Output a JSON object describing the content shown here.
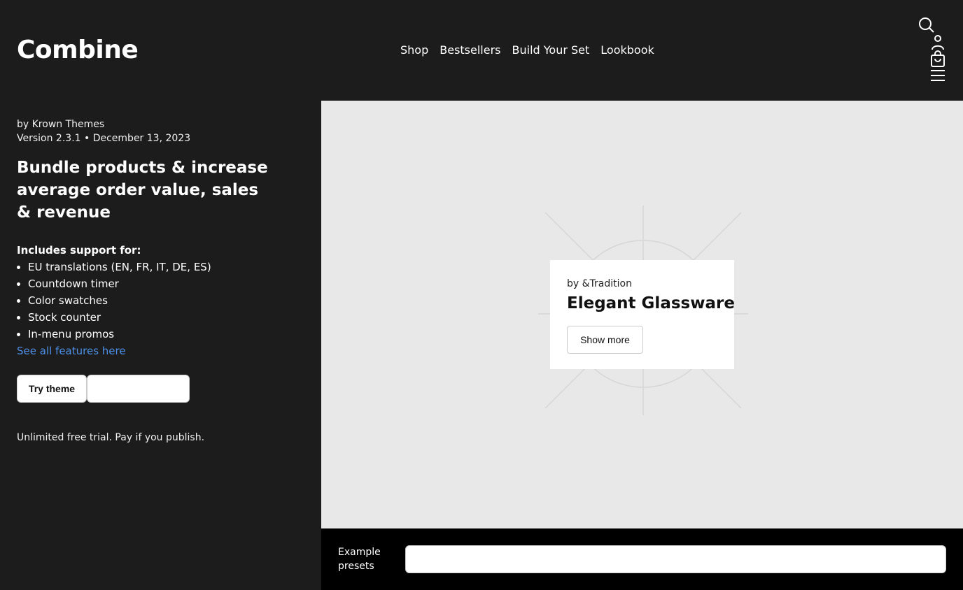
{
  "header": {
    "logo": "Combine",
    "nav": [
      "Shop",
      "Bestsellers",
      "Build Your Set",
      "Lookbook"
    ],
    "icons": [
      "search-icon",
      "account-icon",
      "cart-icon",
      "menu-icon"
    ]
  },
  "sidebar": {
    "author": "by Krown Themes",
    "version": "Version 2.3.1 • December 13, 2023",
    "headline": "Bundle products & increase average order value, sales & revenue",
    "support_title": "Includes support for:",
    "features": [
      "EU translations (EN, FR, IT, DE, ES)",
      "Countdown timer",
      "Color swatches",
      "Stock counter",
      "In-menu promos"
    ],
    "features_link": "See all features here",
    "try_button": "Try theme",
    "trial_note": "Unlimited free trial. Pay if you publish."
  },
  "preview": {
    "brand": "by &Tradition",
    "title": "Elegant Glassware",
    "button": "Show more"
  },
  "presets": {
    "label": "Example presets"
  },
  "colors": {
    "background": "#1c1c1c",
    "link": "#4d8fe6",
    "preview_bg": "#e8e8e8"
  }
}
